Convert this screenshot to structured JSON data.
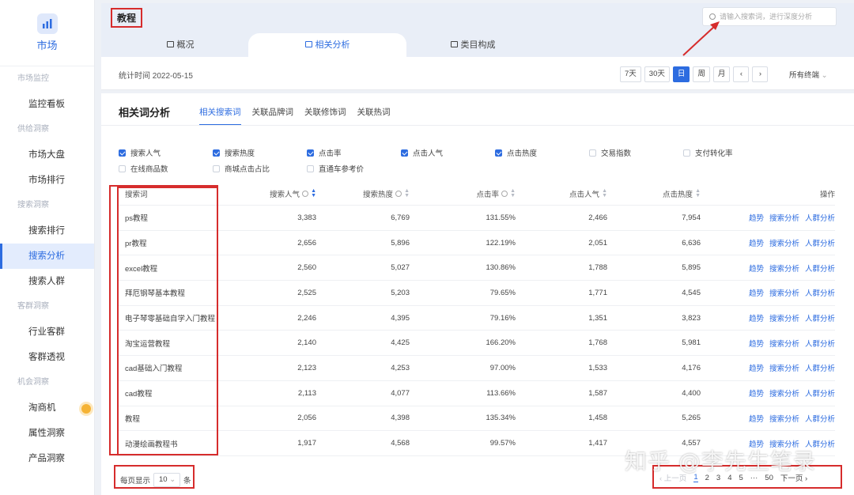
{
  "sidebar": {
    "logo_label": "市场",
    "sections": [
      {
        "group": "市场监控",
        "items": [
          "监控看板"
        ]
      },
      {
        "group": "供给洞察",
        "items": [
          "市场大盘",
          "市场排行"
        ]
      },
      {
        "group": "搜索洞察",
        "items": [
          "搜索排行",
          "搜索分析",
          "搜索人群"
        ]
      },
      {
        "group": "客群洞察",
        "items": [
          "行业客群",
          "客群透视"
        ]
      },
      {
        "group": "机会洞察",
        "items": [
          "淘商机",
          "属性洞察",
          "产品洞察"
        ]
      }
    ],
    "active_item": "搜索分析"
  },
  "header": {
    "crumb": "教程",
    "search_placeholder": "请输入搜索词，进行深度分析",
    "tabs": [
      "概况",
      "相关分析",
      "类目构成"
    ],
    "active_tab": "相关分析"
  },
  "toolbar": {
    "stat_time": "统计时间 2022-05-15",
    "ranges": [
      "7天",
      "30天",
      "日",
      "周",
      "月"
    ],
    "active_range": "日",
    "prev": "‹",
    "next": "›",
    "terminal": "所有终端"
  },
  "panel": {
    "title": "相关词分析",
    "subtabs": [
      "相关搜索词",
      "关联品牌词",
      "关联修饰词",
      "关联热词"
    ],
    "active_subtab": "相关搜索词"
  },
  "metrics": [
    {
      "label": "搜索人气",
      "checked": true
    },
    {
      "label": "搜索热度",
      "checked": true
    },
    {
      "label": "点击率",
      "checked": true
    },
    {
      "label": "点击人气",
      "checked": true
    },
    {
      "label": "点击热度",
      "checked": true
    },
    {
      "label": "交易指数",
      "checked": false
    },
    {
      "label": "支付转化率",
      "checked": false
    },
    {
      "label": "在线商品数",
      "checked": false
    },
    {
      "label": "商城点击占比",
      "checked": false
    },
    {
      "label": "直通车参考价",
      "checked": false
    }
  ],
  "table": {
    "columns": [
      "搜索词",
      "搜索人气",
      "搜索热度",
      "点击率",
      "点击人气",
      "点击热度",
      "操作"
    ],
    "actions": [
      "趋势",
      "搜索分析",
      "人群分析"
    ],
    "rows": [
      [
        "ps教程",
        "3,383",
        "6,769",
        "131.55%",
        "2,466",
        "7,954"
      ],
      [
        "pr教程",
        "2,656",
        "5,896",
        "122.19%",
        "2,051",
        "6,636"
      ],
      [
        "excel教程",
        "2,560",
        "5,027",
        "130.86%",
        "1,788",
        "5,895"
      ],
      [
        "拜厄钢琴基本教程",
        "2,525",
        "5,203",
        "79.65%",
        "1,771",
        "4,545"
      ],
      [
        "电子琴零基础自学入门教程",
        "2,246",
        "4,395",
        "79.16%",
        "1,351",
        "3,823"
      ],
      [
        "淘宝运营教程",
        "2,140",
        "4,425",
        "166.20%",
        "1,768",
        "5,981"
      ],
      [
        "cad基础入门教程",
        "2,123",
        "4,253",
        "97.00%",
        "1,533",
        "4,176"
      ],
      [
        "cad教程",
        "2,113",
        "4,077",
        "113.66%",
        "1,587",
        "4,400"
      ],
      [
        "教程",
        "2,056",
        "4,398",
        "135.34%",
        "1,458",
        "5,265"
      ],
      [
        "动漫绘画教程书",
        "1,917",
        "4,568",
        "99.57%",
        "1,417",
        "4,557"
      ]
    ]
  },
  "footer": {
    "page_size_prefix": "每页显示",
    "page_size": "10",
    "page_size_suffix": "条",
    "prev_page": "‹ 上一页",
    "pages": [
      "1",
      "2",
      "3",
      "4",
      "5",
      "···",
      "50"
    ],
    "current_page": "1",
    "next_page": "下一页 ›"
  },
  "watermark": "知乎 @李先生笔录",
  "colors": {
    "accent": "#2d6ce0",
    "annotation_red": "#d62c2c",
    "sidebar_dot": "#f5b335"
  }
}
